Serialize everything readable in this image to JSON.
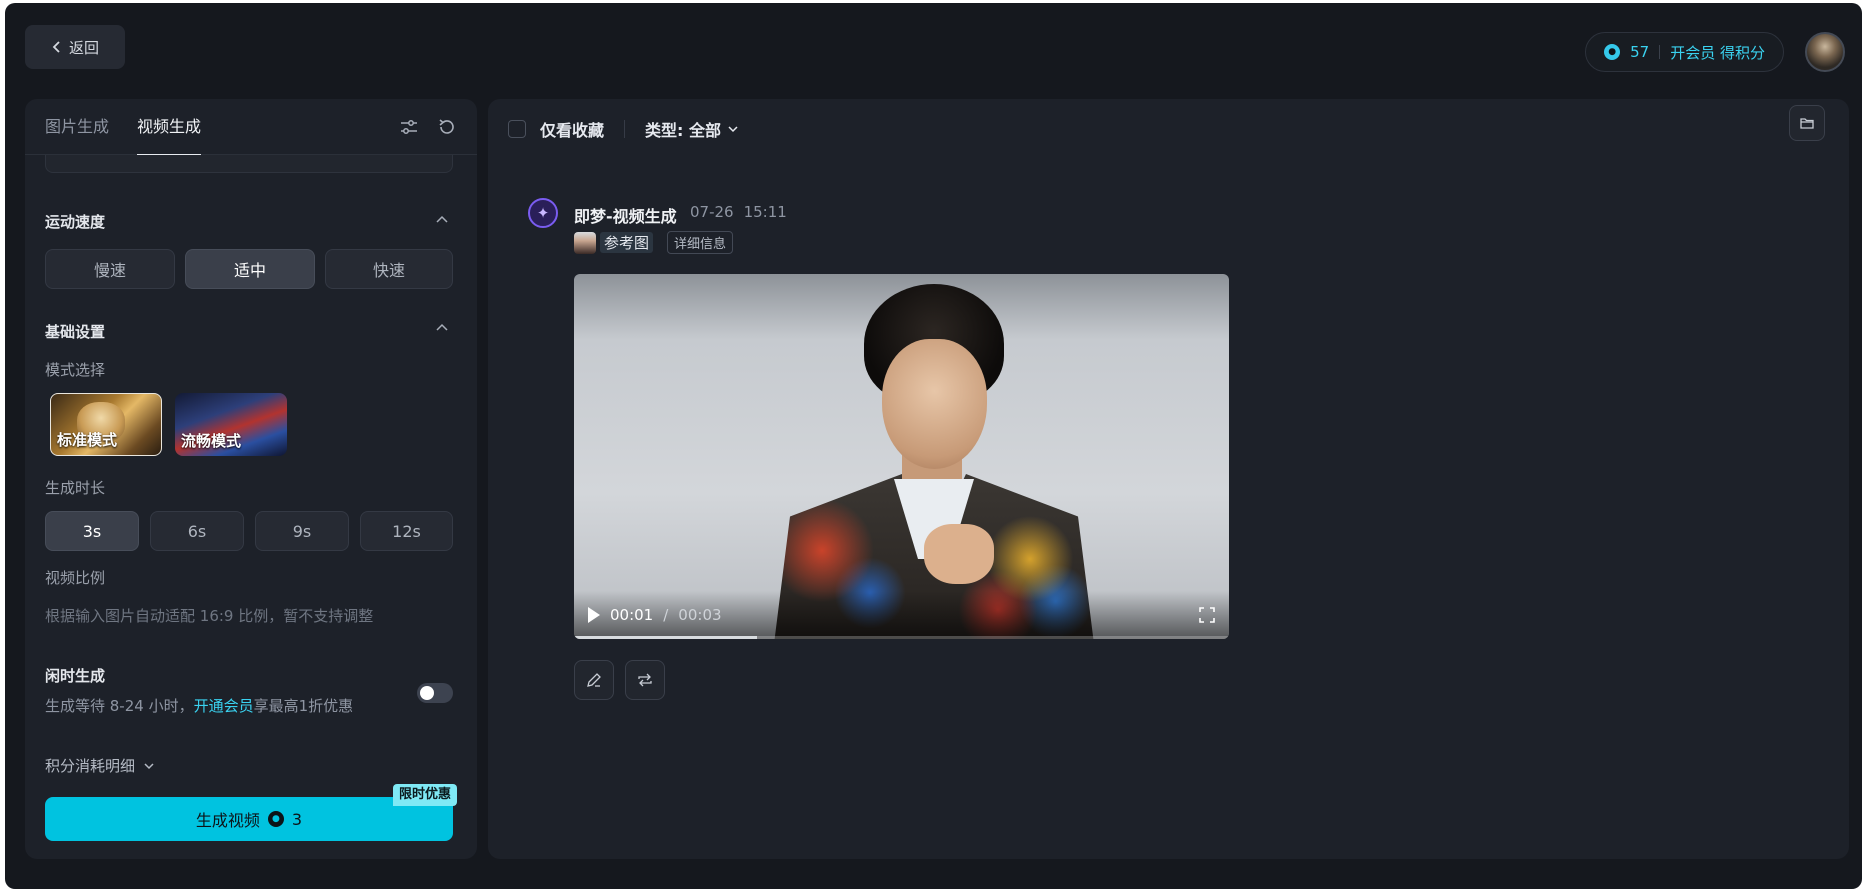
{
  "header": {
    "back_label": "返回",
    "credits_value": "57",
    "vip_label": "开会员 得积分"
  },
  "left_panel": {
    "tabs": [
      {
        "label": "图片生成",
        "active": false
      },
      {
        "label": "视频生成",
        "active": true
      }
    ],
    "motion_speed": {
      "title": "运动速度",
      "options": [
        "慢速",
        "适中",
        "快速"
      ],
      "selected": "适中"
    },
    "basic_settings": {
      "title": "基础设置",
      "mode_label": "模式选择",
      "modes": [
        {
          "label": "标准模式",
          "selected": true
        },
        {
          "label": "流畅模式",
          "selected": false
        }
      ],
      "duration_label": "生成时长",
      "durations": [
        "3s",
        "6s",
        "9s",
        "12s"
      ],
      "duration_selected": "3s",
      "ratio_label": "视频比例",
      "ratio_desc": "根据输入图片自动适配 16:9 比例，暂不支持调整"
    },
    "idle": {
      "title": "闲时生成",
      "desc_prefix": "生成等待 8-24 小时，",
      "desc_link": "开通会员",
      "desc_suffix": "享最高1折优惠",
      "enabled": false
    },
    "cost_label": "积分消耗明细",
    "generate": {
      "label": "生成视频",
      "cost": "3",
      "promo": "限时优惠"
    },
    "accent_color": "#00c3e0"
  },
  "right_panel": {
    "filter": {
      "favorites_label": "仅看收藏",
      "type_label": "类型: 全部"
    },
    "item": {
      "title": "即梦-视频生成",
      "date": "07-26",
      "time": "15:11",
      "ref_label": "参考图",
      "detail_label": "详细信息",
      "video": {
        "current": "00:01",
        "separator": "/",
        "duration": "00:03",
        "progress": 0.28
      }
    }
  },
  "icons": [
    "chevron-left-icon",
    "coin-icon",
    "sliders-icon",
    "refresh-icon",
    "chevron-up-icon",
    "chevron-down-icon",
    "folder-icon",
    "star-spark-icon",
    "play-icon",
    "fullscreen-icon",
    "edit-icon",
    "repeat-icon"
  ]
}
